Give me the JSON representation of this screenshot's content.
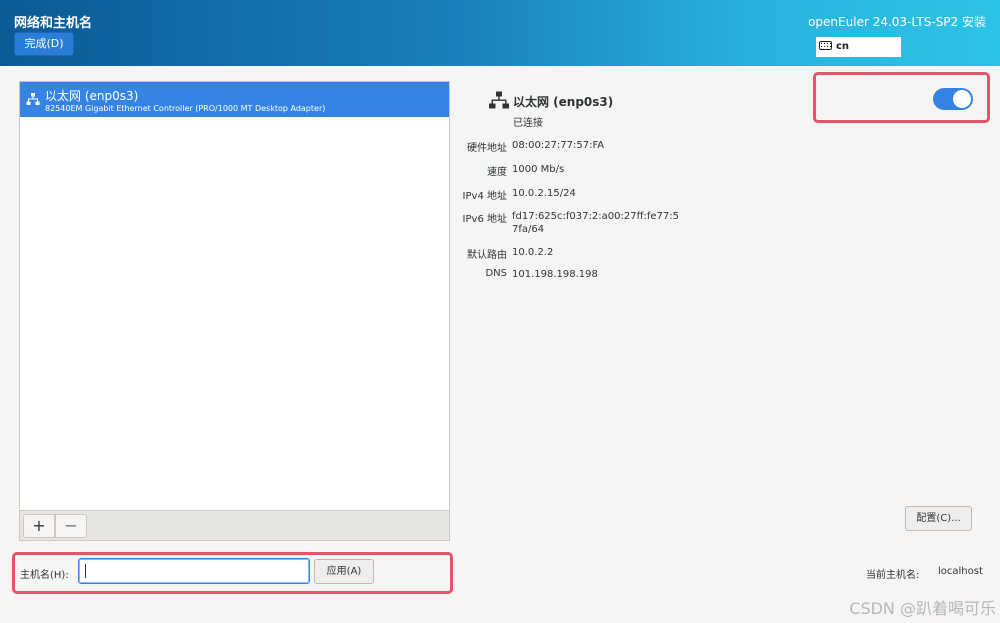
{
  "header": {
    "title": "网络和主机名",
    "done_label": "完成(D)",
    "product": "openEuler 24.03-LTS-SP2 安装",
    "keyboard_layout": "cn"
  },
  "device_list": {
    "items": [
      {
        "name": "以太网 (enp0s3)",
        "description": "82540EM Gigabit Ethernet Controller (PRO/1000 MT Desktop Adapter)",
        "selected": true
      }
    ],
    "add_label": "+",
    "remove_label": "−"
  },
  "hostname": {
    "label": "主机名(H):",
    "value": "",
    "apply_label": "应用(A)",
    "current_label": "当前主机名:",
    "current_value": "localhost"
  },
  "details": {
    "name": "以太网 (enp0s3)",
    "status": "已连接",
    "toggle_on": true,
    "rows": [
      {
        "label": "硬件地址",
        "value": "08:00:27:77:57:FA"
      },
      {
        "label": "速度",
        "value": "1000 Mb/s"
      },
      {
        "label": "IPv4 地址",
        "value": "10.0.2.15/24"
      },
      {
        "label": "IPv6 地址",
        "value": "fd17:625c:f037:2:a00:27ff:fe77:57fa/64"
      },
      {
        "label": "默认路由",
        "value": "10.0.2.2"
      },
      {
        "label": "DNS",
        "value": "101.198.198.198"
      }
    ],
    "config_label": "配置(C)..."
  },
  "watermark": "CSDN @趴着喝可乐",
  "colors": {
    "accent": "#3584e4",
    "highlight_border": "#e8526a",
    "header_start": "#0c5a95",
    "header_end": "#2cc3e6"
  }
}
